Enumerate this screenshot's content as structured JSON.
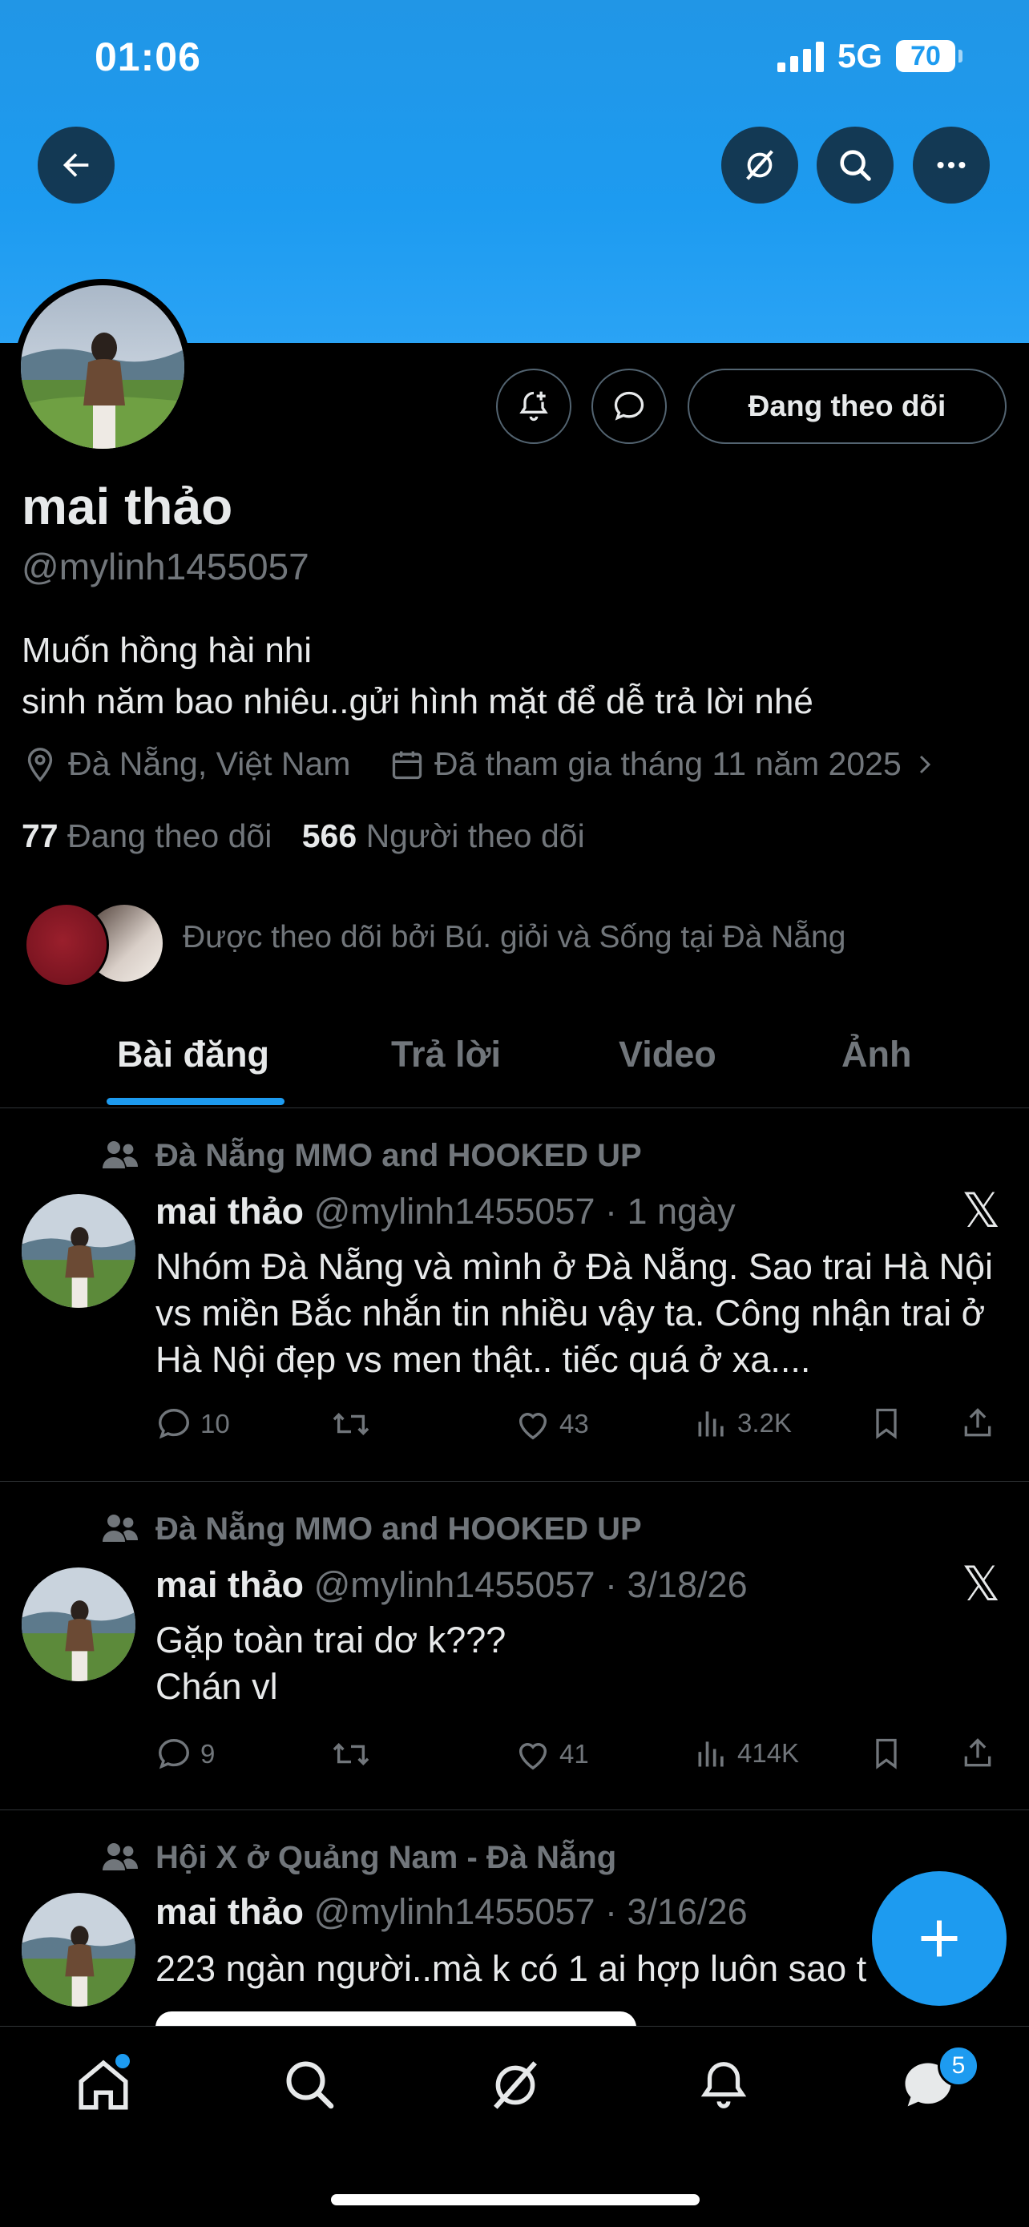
{
  "status_bar": {
    "time": "01:06",
    "network": "5G",
    "battery": "70"
  },
  "profile": {
    "name": "mai thảo",
    "handle": "@mylinh1455057",
    "bio_line1": "Muốn hồng hài nhi",
    "bio_line2": "sinh năm bao nhiêu..gửi hình mặt để dễ trả lời nhé",
    "location": "Đà Nẵng, Việt Nam",
    "joined": "Đã tham gia tháng 11 năm 2025",
    "following_count": "77",
    "following_label": "Đang theo dõi",
    "followers_count": "566",
    "followers_label": "Người theo dõi",
    "followed_by": "Được theo dõi bởi Bú. giỏi và Sống tại Đà Nẵng",
    "follow_button": "Đang theo dõi"
  },
  "tabs": [
    {
      "label": "Bài đăng",
      "active": true
    },
    {
      "label": "Trả lời",
      "active": false
    },
    {
      "label": "Video",
      "active": false
    },
    {
      "label": "Ảnh",
      "active": false
    }
  ],
  "posts": [
    {
      "community": "Đà Nẵng MMO and HOOKED UP",
      "name": "mai thảo",
      "meta": "@mylinh1455057 · 1 ngày",
      "text": "Nhóm Đà Nẵng và mình ở Đà Nẵng. Sao trai Hà Nội vs miền Bắc nhắn tin nhiều vậy ta.  Công nhận trai ở Hà Nội đẹp vs men thật.. tiếc quá ở xa....",
      "replies": "10",
      "reposts": "",
      "likes": "43",
      "views": "3.2K"
    },
    {
      "community": "Đà Nẵng MMO and HOOKED UP",
      "name": "mai thảo",
      "meta": "@mylinh1455057 · 3/18/26",
      "text_line1": "Gặp toàn trai dơ k???",
      "text_line2": "Chán vl",
      "replies": "9",
      "reposts": "",
      "likes": "41",
      "views": "414K"
    },
    {
      "community": "Hội X ở Quảng Nam - Đà Nẵng",
      "name": "mai thảo",
      "meta": "@mylinh1455057 · 3/16/26",
      "text": "223 ngàn người..mà k có 1 ai hợp luôn sao t"
    }
  ],
  "notifications_badge": "5",
  "colors": {
    "accent": "#1d9bf0",
    "muted": "#71767b",
    "text": "#e7e9ea",
    "border": "#2f3336"
  }
}
